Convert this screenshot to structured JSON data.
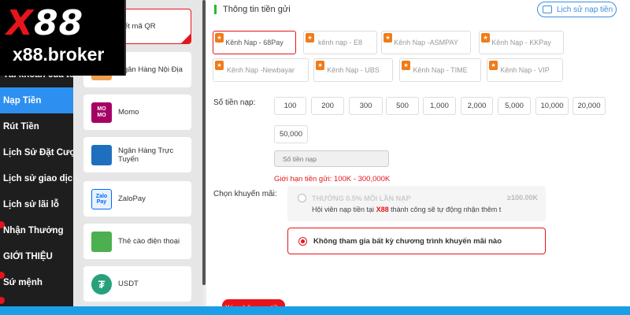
{
  "logo": {
    "brand_x": "X",
    "brand_num": "88",
    "domain": "x88.broker"
  },
  "sidebar": {
    "items": [
      {
        "label": "Tài khoản của tôi"
      },
      {
        "label": "Nạp Tiền"
      },
      {
        "label": "Rút Tiền"
      },
      {
        "label": "Lịch Sử Đặt Cược"
      },
      {
        "label": "Lịch sử giao dịch"
      },
      {
        "label": "Lịch sử lãi lỗ"
      },
      {
        "label": "Nhận Thưởng"
      },
      {
        "label": "GIỚI THIỆU"
      },
      {
        "label": "Sứ mệnh"
      }
    ],
    "active": "Nạp Tiền"
  },
  "methods": [
    {
      "label": "ết mã QR",
      "icon": "qr-icon"
    },
    {
      "label": "Ngân Hàng Nội Địa",
      "icon": "bank-icon"
    },
    {
      "label": "Momo",
      "icon": "momo-icon",
      "icon_text": "mo\nmo"
    },
    {
      "label": "Ngân Hàng Trực Tuyến",
      "icon": "online-bank-icon"
    },
    {
      "label": "ZaloPay",
      "icon": "zalopay-icon",
      "icon_text": "Zalo Pay"
    },
    {
      "label": "Thẻ cào điện thoại",
      "icon": "phone-card-icon"
    },
    {
      "label": "USDT",
      "icon": "usdt-icon",
      "icon_text": "₮"
    }
  ],
  "deposit": {
    "section_title": "Thông tin tiền gửi",
    "history_button": "Lịch sử nạp tiền",
    "channels": [
      "Kênh Nạp - 68Pay",
      "kênh nạp - E8",
      "Kênh Nạp -ASMPAY",
      "Kênh Nạp - KKPay",
      "Kênh Nạp -Newbayar",
      "Kênh Nạp - UBS",
      "Kênh Nạp - TIME",
      "Kênh Nạp - VIP"
    ],
    "selected_channel": "Kênh Nạp - 68Pay",
    "amount_label": "Số tiền nạp:",
    "amounts": [
      "100",
      "200",
      "300",
      "500",
      "1,000",
      "2,000",
      "5,000",
      "10,000",
      "20,000",
      "50,000"
    ],
    "amount_placeholder": "Số tiền nạp",
    "limit_text": "Giới hạn tiền gửi:  100K - 300,000K",
    "promo_label": "Chọn khuyến mãi:",
    "promo_option_title": "THƯỞNG 0.5% MỖI LẦN NẠP",
    "promo_option_amount": "≥100.00K",
    "promo_option_desc_pre": "Hội viên nạp tiền tại ",
    "promo_option_desc_brand": "X88",
    "promo_option_desc_post": " thành công sẽ tự động nhận thêm t",
    "promo_none": "Không tham gia bất kỳ chương trình khuyến mãi nào",
    "submit_label": "Xác nhận nạp tiền"
  },
  "colors": {
    "accent_red": "#e8141b",
    "active_blue": "#2d8ff0",
    "link_blue": "#3d8de0",
    "title_green": "#2eb82e"
  }
}
